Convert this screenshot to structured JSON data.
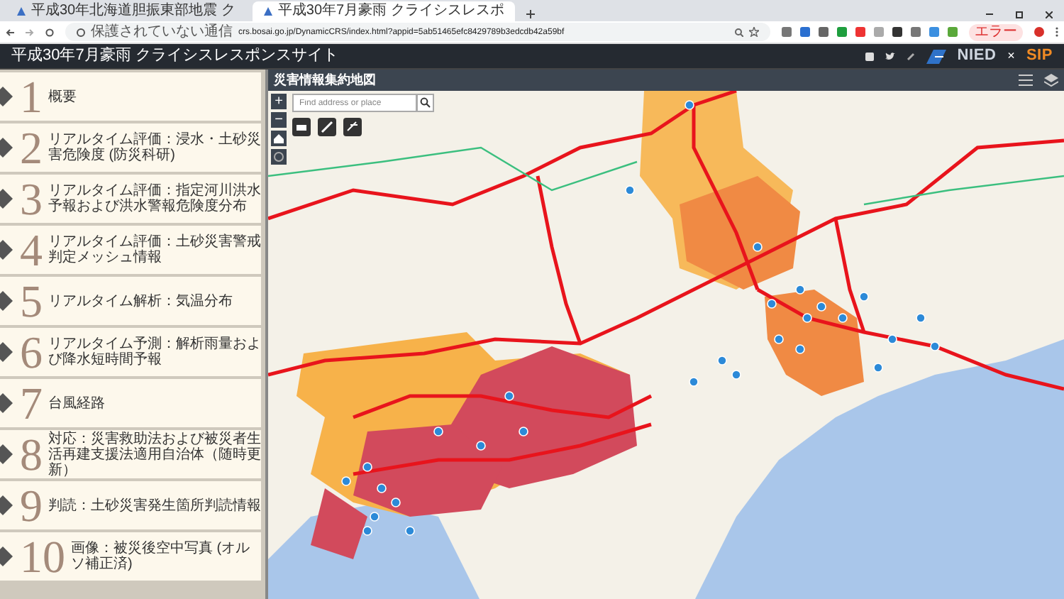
{
  "browser": {
    "tabs": [
      {
        "title": "平成30年北海道胆振東部地震 ク",
        "selected": false
      },
      {
        "title": "平成30年7月豪雨 クライシスレスポ",
        "selected": true
      }
    ],
    "security": "保護されていない通信",
    "url": "crs.bosai.go.jp/DynamicCRS/index.html?appid=5ab51465efc8429789b3edcdb42a59bf",
    "profile_badge": "エラー"
  },
  "header": {
    "title": "平成30年7月豪雨 クライシスレスポンスサイト",
    "logo_1": "NIED",
    "separator": "×",
    "logo_2": "SIP"
  },
  "sidebar": {
    "items": [
      {
        "number": "1",
        "label": "概要"
      },
      {
        "number": "2",
        "label": "リアルタイム評価：浸水・土砂災害危険度 (防災科研)"
      },
      {
        "number": "3",
        "label": "リアルタイム評価：指定河川洪水予報および洪水警報危険度分布"
      },
      {
        "number": "4",
        "label": "リアルタイム評価：土砂災害警戒判定メッシュ情報"
      },
      {
        "number": "5",
        "label": "リアルタイム解析：気温分布"
      },
      {
        "number": "6",
        "label": "リアルタイム予測：解析雨量および降水短時間予報"
      },
      {
        "number": "7",
        "label": "台風経路"
      },
      {
        "number": "8",
        "label": "対応：災害救助法および被災者生活再建支援法適用自治体（随時更新）"
      },
      {
        "number": "9",
        "label": "判読：土砂災害発生箇所判読情報"
      },
      {
        "number": "10",
        "label": "画像：被災後空中写真 (オルソ補正済)"
      }
    ]
  },
  "map": {
    "title": "災害情報集約地図",
    "search": {
      "placeholder": "Find address or place"
    },
    "zoom_in": "+",
    "zoom_out": "−"
  }
}
